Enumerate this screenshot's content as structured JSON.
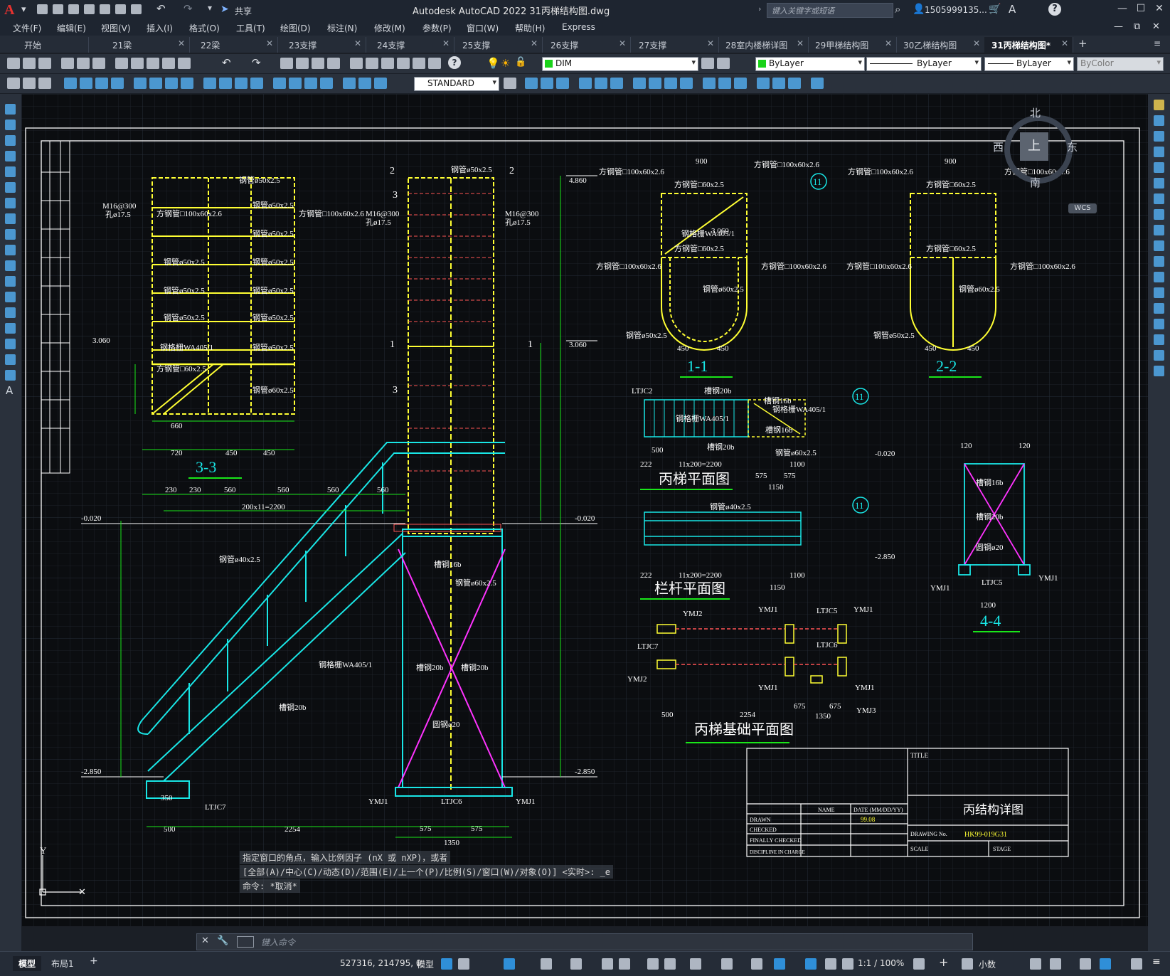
{
  "app": {
    "logo": "A",
    "title": "Autodesk AutoCAD 2022    31丙梯结构图.dwg",
    "share_label": "共享",
    "search_placeholder": "键入关键字或短语",
    "user": "1505999135...",
    "window_buttons": [
      "—",
      "☐",
      "✕"
    ],
    "mdi_buttons": [
      "—",
      "⧉",
      "✕"
    ]
  },
  "menu": [
    "文件(F)",
    "编辑(E)",
    "视图(V)",
    "插入(I)",
    "格式(O)",
    "工具(T)",
    "绘图(D)",
    "标注(N)",
    "修改(M)",
    "参数(P)",
    "窗口(W)",
    "帮助(H)",
    "Express"
  ],
  "tabs": [
    {
      "label": "开始",
      "closable": false
    },
    {
      "label": "21梁",
      "closable": true
    },
    {
      "label": "22梁",
      "closable": true
    },
    {
      "label": "23支撑",
      "closable": true
    },
    {
      "label": "24支撑",
      "closable": true
    },
    {
      "label": "25支撑",
      "closable": true
    },
    {
      "label": "26支撑",
      "closable": true
    },
    {
      "label": "27支撑",
      "closable": true
    },
    {
      "label": "28室内楼梯详图",
      "closable": true
    },
    {
      "label": "29甲梯结构图",
      "closable": true
    },
    {
      "label": "30乙梯结构图",
      "closable": true
    },
    {
      "label": "31丙梯结构图*",
      "closable": true,
      "active": true
    }
  ],
  "tab_add": "+",
  "toolbar": {
    "layer": "DIM",
    "color": "ByLayer",
    "linetype": "ByLayer",
    "lineweight": "ByLayer",
    "plotstyle": "ByColor",
    "textstyle": "STANDARD"
  },
  "viewcube": {
    "north": "北",
    "south": "南",
    "west": "西",
    "east": "东",
    "top": "上",
    "wcs": "WCS"
  },
  "command": {
    "history": [
      "指定窗口的角点，输入比例因子 (nX 或 nXP)，或者",
      "[全部(A)/中心(C)/动态(D)/范围(E)/上一个(P)/比例(S)/窗口(W)/对象(O)] <实时>: _e",
      "命令: *取消*"
    ],
    "placeholder": "键入命令"
  },
  "status": {
    "layout_tabs": [
      "模型",
      "布局1"
    ],
    "coords": "527316, 214795, 0",
    "model": "模型",
    "scale": "1:1 / 100%",
    "units": "小数"
  },
  "drawing": {
    "views": {
      "s33": "3-3",
      "s11": "1-1",
      "s22": "2-2",
      "s44": "4-4",
      "plan": "丙梯平面图",
      "rail": "栏杆平面图",
      "base": "丙梯基础平面图"
    },
    "levels": [
      "4.860",
      "3.060",
      "-0.020",
      "-2.850"
    ],
    "title_block": {
      "title_label": "TITLE",
      "title": "丙结构详图",
      "name_h": "NAME",
      "date_h": "DATE (MM/DD/YY)",
      "drawn": "DRAWN",
      "checked": "CHECKED",
      "final": "FINALLY CHECKED",
      "discipline": "DISCIPLINE IN CHARGE",
      "date": "99.08",
      "dno_label": "DRAWING No.",
      "dno": "HK99-019G31",
      "scale": "SCALE",
      "stage": "STAGE"
    }
  }
}
